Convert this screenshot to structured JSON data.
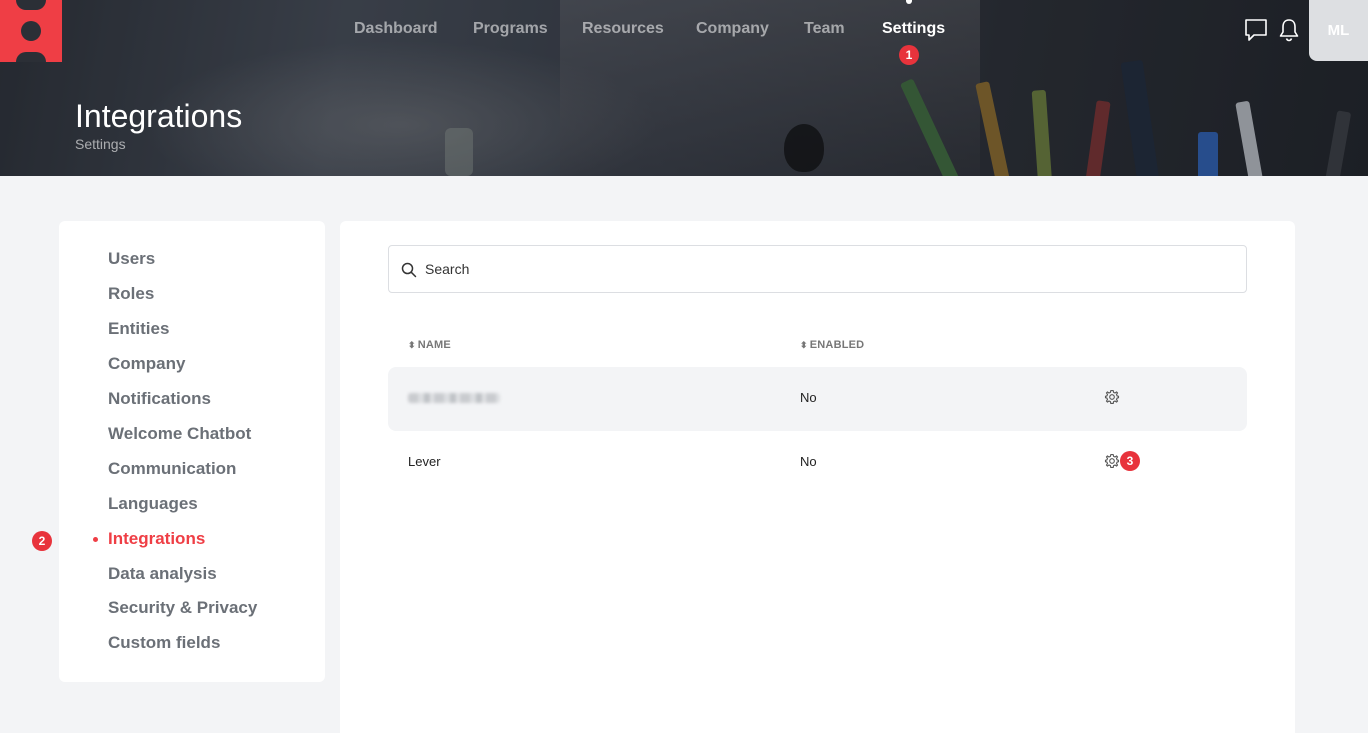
{
  "header": {
    "nav": [
      {
        "label": "Dashboard",
        "active": false
      },
      {
        "label": "Programs",
        "active": false
      },
      {
        "label": "Resources",
        "active": false
      },
      {
        "label": "Company",
        "active": false
      },
      {
        "label": "Team",
        "active": false
      },
      {
        "label": "Settings",
        "active": true
      }
    ],
    "settings_badge": "1",
    "icons": [
      "chat-icon",
      "bell-icon"
    ],
    "avatar_initials": "ML",
    "page_title": "Integrations",
    "page_subtitle": "Settings"
  },
  "sidebar": {
    "items": [
      {
        "label": "Users"
      },
      {
        "label": "Roles"
      },
      {
        "label": "Entities"
      },
      {
        "label": "Company"
      },
      {
        "label": "Notifications"
      },
      {
        "label": "Welcome Chatbot"
      },
      {
        "label": "Communication"
      },
      {
        "label": "Languages"
      },
      {
        "label": "Integrations",
        "active": true
      },
      {
        "label": "Data analysis"
      },
      {
        "label": "Security & Privacy"
      },
      {
        "label": "Custom fields"
      }
    ],
    "active_badge": "2"
  },
  "main": {
    "search_placeholder": "Search",
    "columns": {
      "name": "NAME",
      "enabled": "ENABLED"
    },
    "rows": [
      {
        "name": "",
        "enabled": "No"
      },
      {
        "name": "Lever",
        "enabled": "No",
        "badge": "3"
      }
    ]
  },
  "colors": {
    "accent": "#ef3e45",
    "badge": "#e8333c",
    "page_bg": "#f3f4f6"
  }
}
